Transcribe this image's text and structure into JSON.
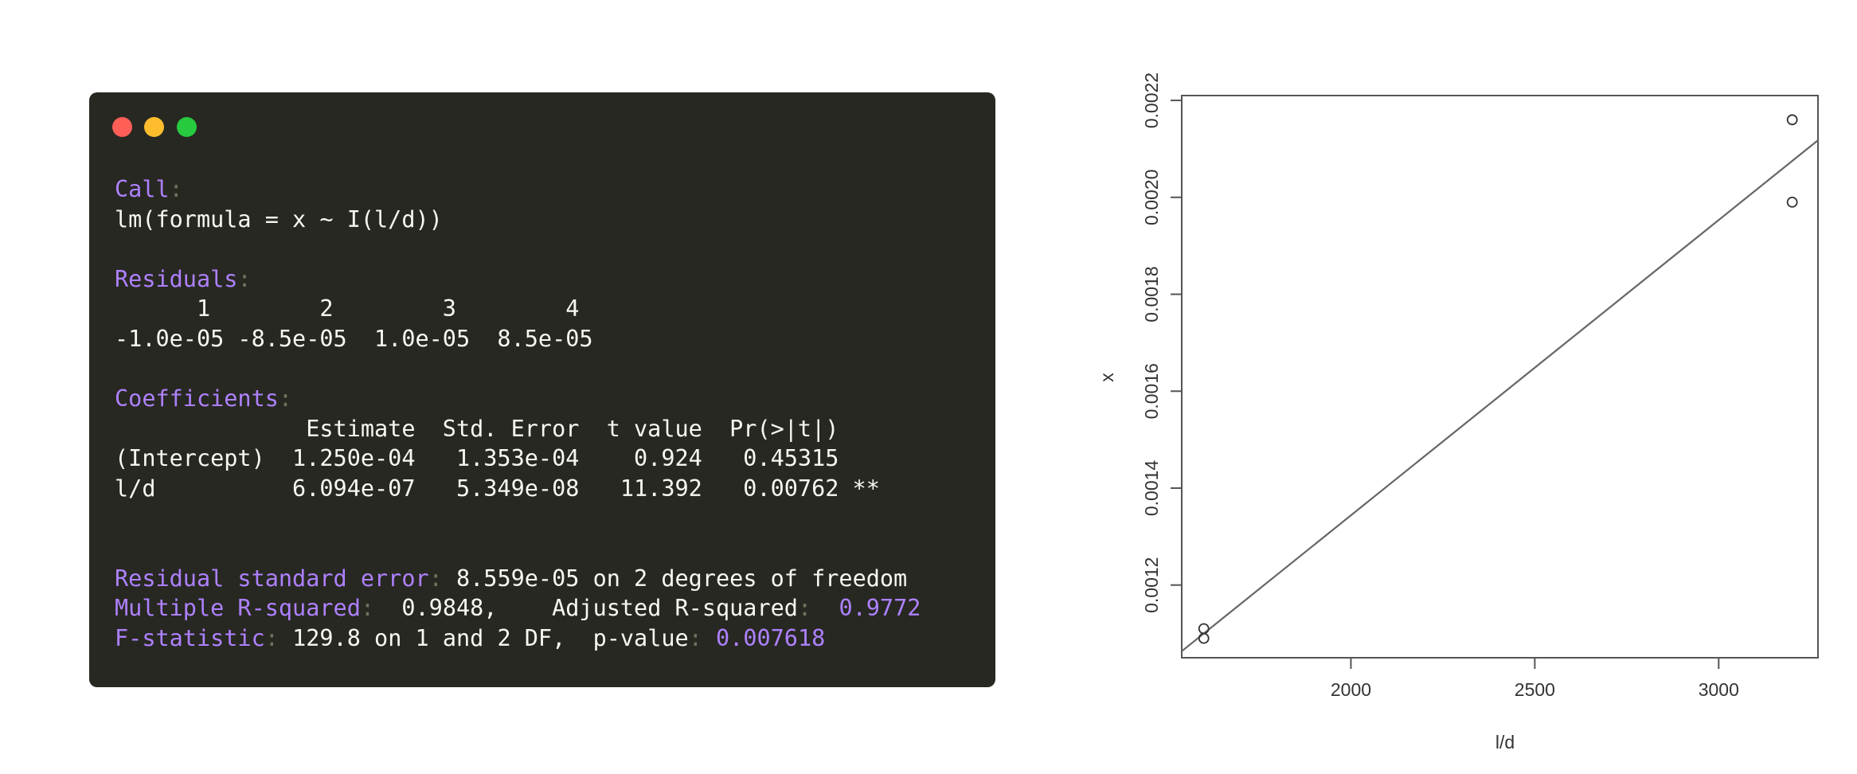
{
  "window": {
    "controls": [
      {
        "name": "close",
        "color": "#ff5f56"
      },
      {
        "name": "minimize",
        "color": "#ffbd2e"
      },
      {
        "name": "zoom",
        "color": "#27c93f"
      }
    ]
  },
  "console": {
    "call_header": "Call",
    "call_text": "lm(formula = x ~ I(l/d))",
    "residuals_header": "Residuals",
    "residuals_index_line": "      1        2        3        4",
    "residuals_values_line": "-1.0e-05 -8.5e-05  1.0e-05  8.5e-05",
    "coefficients_header": "Coefficients",
    "coef_header_line": "              Estimate  Std. Error  t value  Pr(>|t|)",
    "coef_rows": [
      "(Intercept)  1.250e-04   1.353e-04    0.924   0.45315",
      "l/d          6.094e-07   5.349e-08   11.392   0.00762 **"
    ],
    "rse_label": "Residual standard error",
    "rse_value": " 8.559e-05 on 2 degrees of freedom",
    "r2_label": "Multiple R-squared",
    "r2_value": "  0.9848,    ",
    "adj_r2_label": "Adjusted R-squared",
    "adj_r2_value": "  0.9772",
    "f_label": "F-statistic",
    "f_value": " 129.8 on 1 and 2 DF,  ",
    "p_label": "p-value",
    "p_value": " 0.007618",
    "colon": ":"
  },
  "chart_data": {
    "type": "scatter",
    "title": "",
    "xlabel": "l/d",
    "ylabel": "x",
    "xlim": [
      1540,
      3270
    ],
    "ylim": [
      0.00105,
      0.00221
    ],
    "xticks": [
      2000,
      2500,
      3000
    ],
    "xtick_labels": [
      "2000",
      "2500",
      "3000"
    ],
    "yticks": [
      0.0012,
      0.0014,
      0.0016,
      0.0018,
      0.002,
      0.0022
    ],
    "ytick_labels": [
      "0.0012",
      "0.0014",
      "0.0016",
      "0.0018",
      "0.0020",
      "0.0022"
    ],
    "grid": false,
    "points": {
      "x": [
        1600,
        1600,
        3200,
        3200
      ],
      "y": [
        0.00111,
        0.00109,
        0.00199,
        0.00216
      ]
    },
    "fit_line": {
      "intercept": 0.000125,
      "slope": 6.094e-07
    },
    "colors": {
      "axis": "#555555",
      "points": "#333333",
      "line": "#666666"
    }
  }
}
